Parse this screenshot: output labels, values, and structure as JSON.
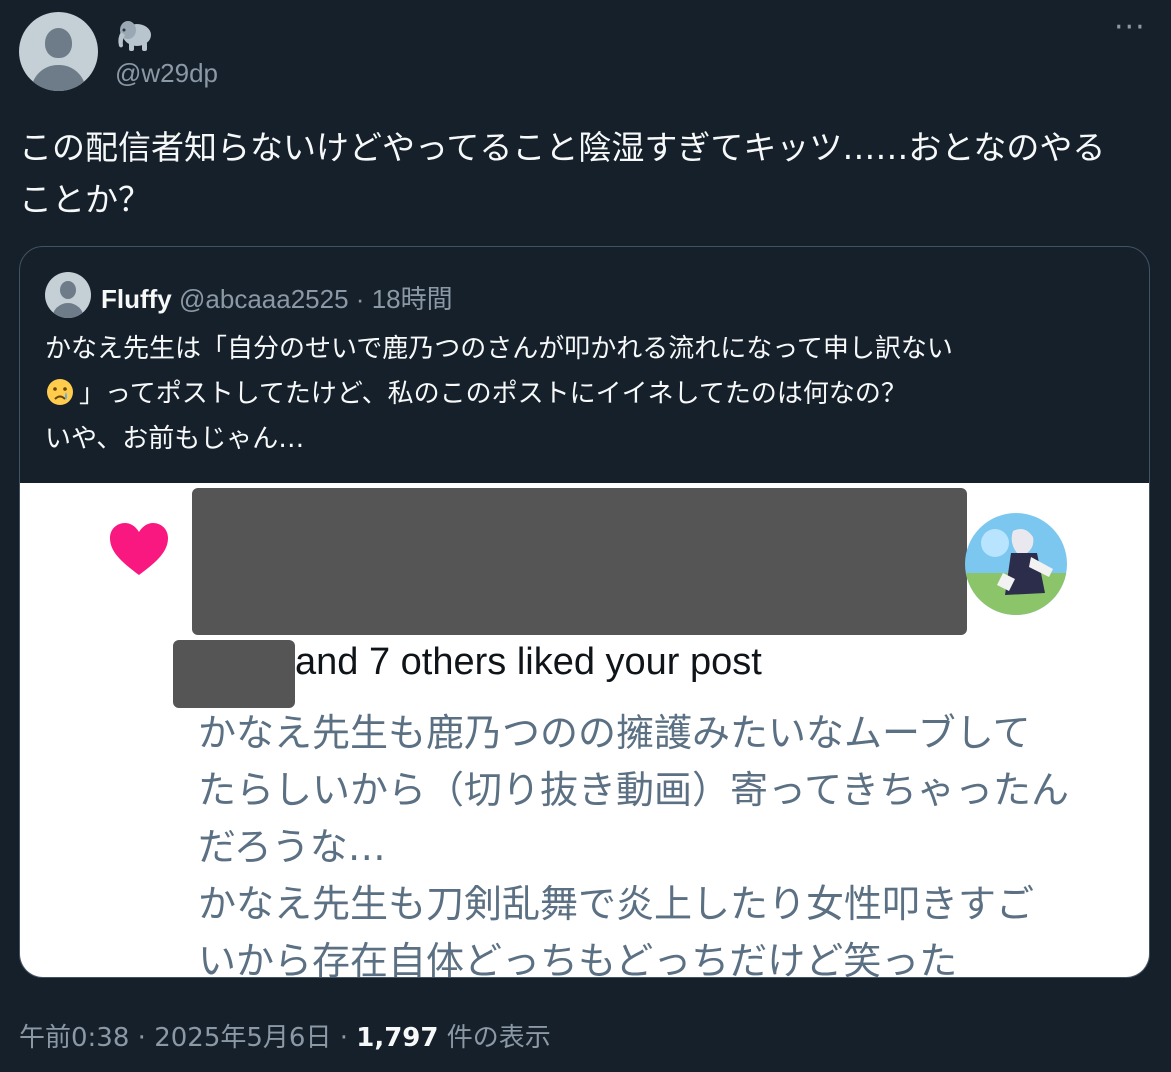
{
  "author": {
    "display_name_icon": "elephant-emoji-icon",
    "handle": "@w29dp",
    "avatar_icon": "default-avatar-icon"
  },
  "menu": {
    "more_label": "···"
  },
  "tweet": {
    "text_line1": "この配信者知らないけどやってること陰湿すぎてキッツ……おとなのやる",
    "text_line2": "ことか？"
  },
  "quote": {
    "display_name": "Fluffy",
    "handle": "@abcaaa2525",
    "separator": "·",
    "time": "18時間",
    "text_line1": "かなえ先生は「自分のせいで鹿乃つのさんが叩かれる流れになって申し訳ない",
    "text_line2": "」ってポストしてたけど、私のこのポストにイイネしてたのは何なの？",
    "text_line3": "いや、お前もじゃん…",
    "emoji_icon": "crying-face-icon"
  },
  "screenshot": {
    "heart_color": "#f91880",
    "liked_text": "and 7 others liked your post",
    "preview_line1": "かなえ先生も鹿乃つのの擁護みたいなムーブして",
    "preview_line2": "たらしいから（切り抜き動画）寄ってきちゃったん",
    "preview_line3": "だろうな…",
    "preview_line4": "かなえ先生も刀剣乱舞で炎上したり女性叩きすご",
    "preview_line5": "いから存在自体どっちもどっちだけど笑った"
  },
  "footer": {
    "time": "午前0:38",
    "separator": "·",
    "date": "2025年5月6日",
    "views_count": "1,797",
    "views_label": "件の表示"
  },
  "colors": {
    "background": "#15202b",
    "text_primary": "#f7f9f9",
    "text_secondary": "#8b98a5",
    "border": "#425364",
    "like_pink": "#f91880",
    "redaction_gray": "#555555"
  }
}
